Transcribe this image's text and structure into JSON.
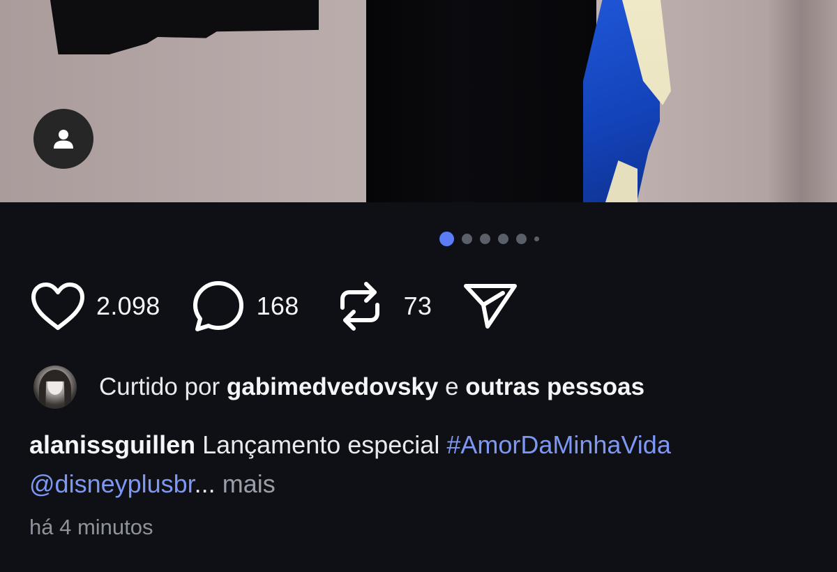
{
  "post": {
    "carousel": {
      "total_slides": 6,
      "active_index": 0
    },
    "actions": {
      "likes": "2.098",
      "comments": "168",
      "reposts": "73"
    },
    "liked_by": {
      "prefix": "Curtido por",
      "username": "gabimedvedovsky",
      "conjunction": "e",
      "others": "outras pessoas"
    },
    "caption": {
      "author": "alanissguillen",
      "text": "Lançamento especial",
      "hashtag": "#AmorDaMinhaVida",
      "mention": "@disneyplusbr",
      "ellipsis": "...",
      "more": "mais"
    },
    "timestamp": "há 4 minutos"
  },
  "icons": {
    "user_tag": "person-icon",
    "like": "heart-icon",
    "comment": "comment-bubble-icon",
    "repost": "repost-icon",
    "share": "send-icon"
  },
  "colors": {
    "background": "#0e1015",
    "accent": "#5b7cf5",
    "link": "#7e97f3",
    "muted": "#8e929b"
  }
}
